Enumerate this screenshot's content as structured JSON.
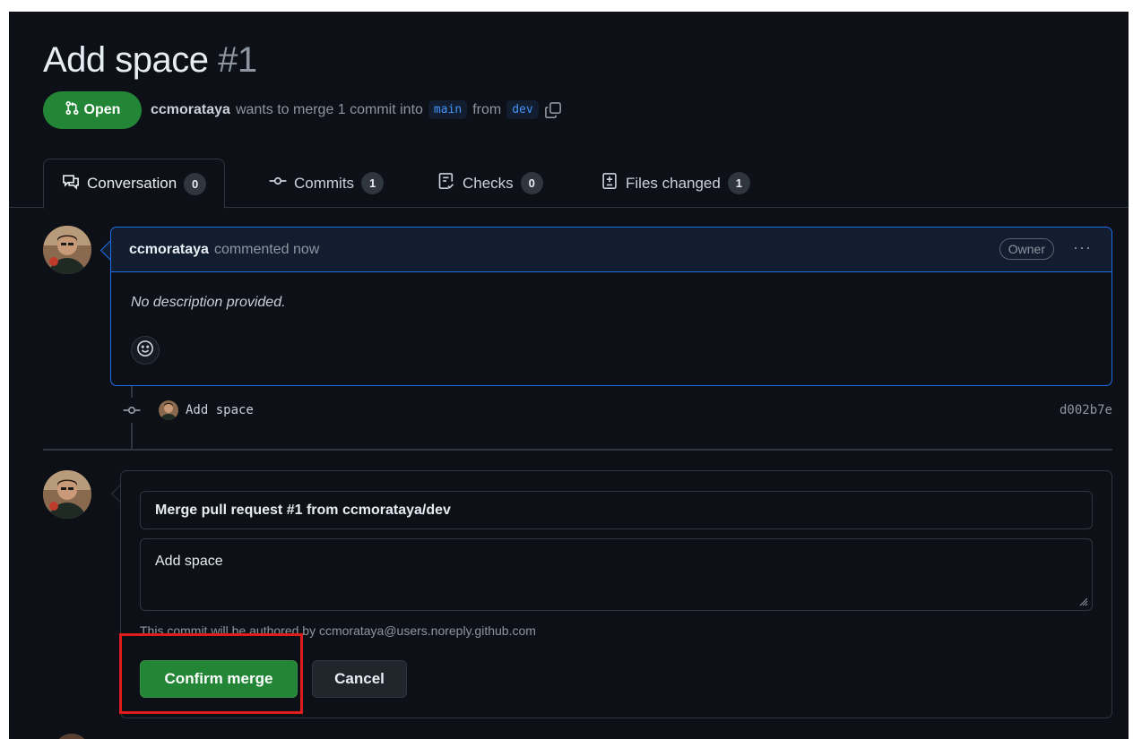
{
  "pr": {
    "title": "Add space",
    "number": "#1",
    "state": "Open",
    "author": "ccmorataya",
    "merge_text_1": "wants to merge 1 commit into",
    "base_branch": "main",
    "merge_text_2": "from",
    "head_branch": "dev"
  },
  "tabs": [
    {
      "label": "Conversation",
      "count": "0",
      "icon": "conversation-icon"
    },
    {
      "label": "Commits",
      "count": "1",
      "icon": "commit-icon"
    },
    {
      "label": "Checks",
      "count": "0",
      "icon": "checklist-icon"
    },
    {
      "label": "Files changed",
      "count": "1",
      "icon": "diff-icon"
    }
  ],
  "comment": {
    "author": "ccmorataya",
    "action": "commented now",
    "role_badge": "Owner",
    "menu": "···",
    "body": "No description provided."
  },
  "commit": {
    "message": "Add space",
    "sha": "d002b7e"
  },
  "merge": {
    "title_value": "Merge pull request #1 from ccmorataya/dev",
    "body_value": "Add space",
    "author_note": "This commit will be authored by ccmorataya@users.noreply.github.com",
    "confirm_label": "Confirm merge",
    "cancel_label": "Cancel"
  },
  "colors": {
    "background": "#0d1117",
    "success_green": "#238636",
    "accent_blue": "#1f6feb",
    "highlight_red": "#e01d1d"
  }
}
